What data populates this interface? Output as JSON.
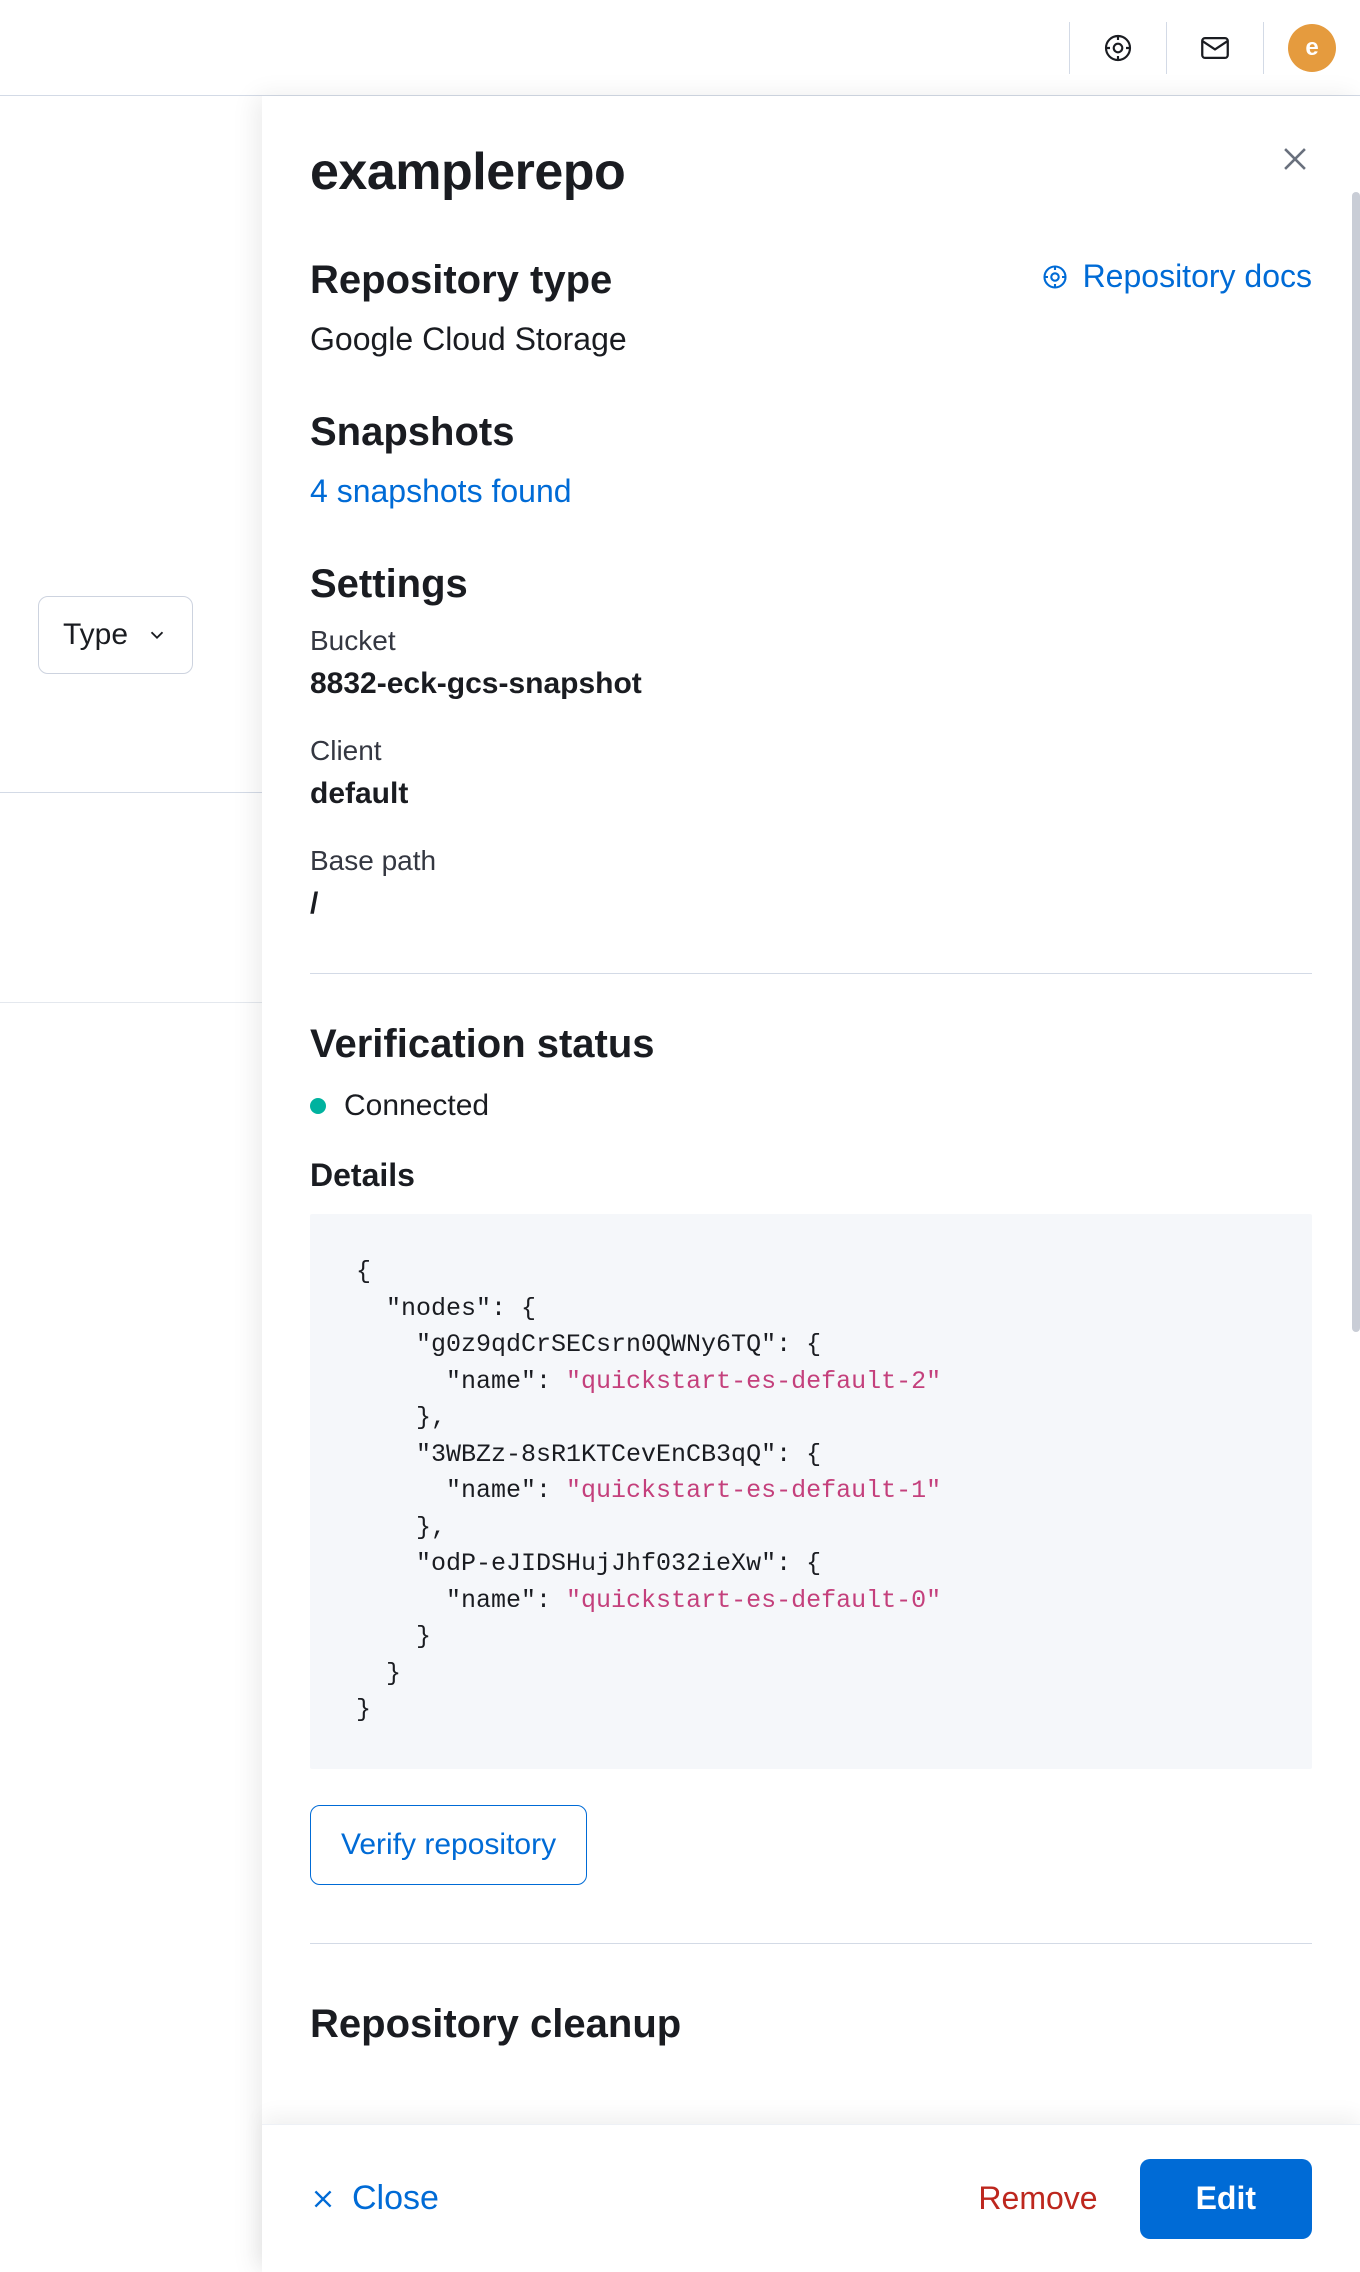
{
  "topbar": {
    "avatar_initial": "e"
  },
  "background": {
    "type_filter_label": "Type"
  },
  "flyout": {
    "title": "examplerepo",
    "docs_link": "Repository docs",
    "sections": {
      "repo_type": {
        "heading": "Repository type",
        "value": "Google Cloud Storage"
      },
      "snapshots": {
        "heading": "Snapshots",
        "link": "4 snapshots found"
      },
      "settings": {
        "heading": "Settings",
        "bucket_label": "Bucket",
        "bucket_value": "8832-eck-gcs-snapshot",
        "client_label": "Client",
        "client_value": "default",
        "basepath_label": "Base path",
        "basepath_value": "/"
      },
      "verification": {
        "heading": "Verification status",
        "status": "Connected",
        "details_heading": "Details",
        "nodes": [
          {
            "id": "g0z9qdCrSECsrn0QWNy6TQ",
            "name": "quickstart-es-default-2"
          },
          {
            "id": "3WBZz-8sR1KTCevEnCB3qQ",
            "name": "quickstart-es-default-1"
          },
          {
            "id": "odP-eJIDSHujJhf032ieXw",
            "name": "quickstart-es-default-0"
          }
        ],
        "verify_button": "Verify repository"
      },
      "cleanup": {
        "heading": "Repository cleanup"
      }
    },
    "footer": {
      "close": "Close",
      "remove": "Remove",
      "edit": "Edit"
    }
  }
}
